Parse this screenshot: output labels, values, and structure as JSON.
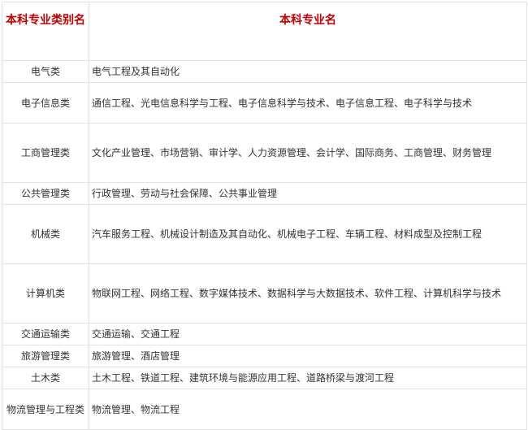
{
  "header": {
    "category": "本科专业类别名",
    "majors": "本科专业名"
  },
  "rows": [
    {
      "category": "电气类",
      "majors": "电气工程及其自动化"
    },
    {
      "category": "电子信息类",
      "majors": "通信工程、光电信息科学与工程、电子信息科学与技术、电子信息工程、电子科学与技术"
    },
    {
      "category": "工商管理类",
      "majors": "文化产业管理、市场营销、审计学、人力资源管理、会计学、国际商务、工商管理、财务管理"
    },
    {
      "category": "公共管理类",
      "majors": "行政管理、劳动与社会保障、公共事业管理"
    },
    {
      "category": "机械类",
      "majors": "汽车服务工程、机械设计制造及其自动化、机械电子工程、车辆工程、材料成型及控制工程"
    },
    {
      "category": "计算机类",
      "majors": "物联网工程、网络工程、数字媒体技术、数据科学与大数据技术、软件工程、计算机科学与技术"
    },
    {
      "category": "交通运输类",
      "majors": "交通运输、交通工程"
    },
    {
      "category": "旅游管理类",
      "majors": "旅游管理、酒店管理"
    },
    {
      "category": "土木类",
      "majors": "土木工程、铁道工程、建筑环境与能源应用工程、道路桥梁与渡河工程"
    },
    {
      "category": "物流管理与工程类",
      "majors": "物流管理、物流工程"
    }
  ]
}
